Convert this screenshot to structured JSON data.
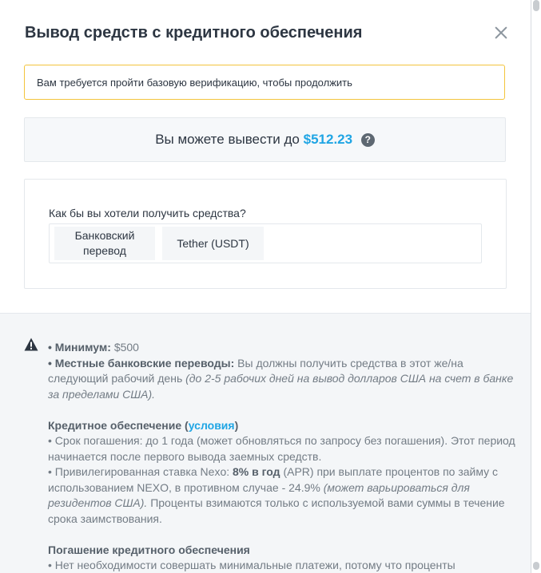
{
  "modal": {
    "title": "Вывод средств с кредитного обеспечения"
  },
  "alert": {
    "text": "Вам требуется пройти базовую верификацию, чтобы продолжить",
    "border_color": "#f3c43c"
  },
  "withdraw": {
    "prefix": "Вы можете вывести до",
    "amount": "$512.23",
    "amount_color": "#1fa5e4",
    "help_glyph": "?"
  },
  "method": {
    "question": "Как бы вы хотели получить средства?",
    "options": [
      {
        "line1": "Банковский",
        "line2": "перевод"
      },
      {
        "label": "Tether (USDT)"
      }
    ]
  },
  "info": {
    "minimum_label": "• Минимум:",
    "minimum_value": "$500",
    "local_label": "• Местные банковские переводы:",
    "local_text": "Вы должны получить средства в этот же/на следующий рабочий день",
    "local_note": "(до 2-5 рабочих дней на вывод долларов США на счет в банке за пределами США).",
    "credit_heading": "Кредитное обеспечение (",
    "credit_link": "условия",
    "credit_heading_end": ")",
    "term_text": "• Срок погашения: до 1 года (может обновляться по запросу без погашения). Этот период начинается после первого вывода заемных средств.",
    "rate_prefix": "• Привилегированная ставка Nexo:",
    "rate_value": "8% в год",
    "rate_text": "(APR) при выплате процентов по займу с использованием NEXO, в противном случае - 24.9%",
    "rate_note": "(может варьироваться для резидентов США).",
    "rate_tail": "Проценты взимаются только с используемой вами суммы в течение срока заимствования.",
    "repay_heading": "Погашение кредитного обеспечения",
    "repay_text": "• Нет необходимости совершать минимальные платежи, потому что проценты"
  }
}
